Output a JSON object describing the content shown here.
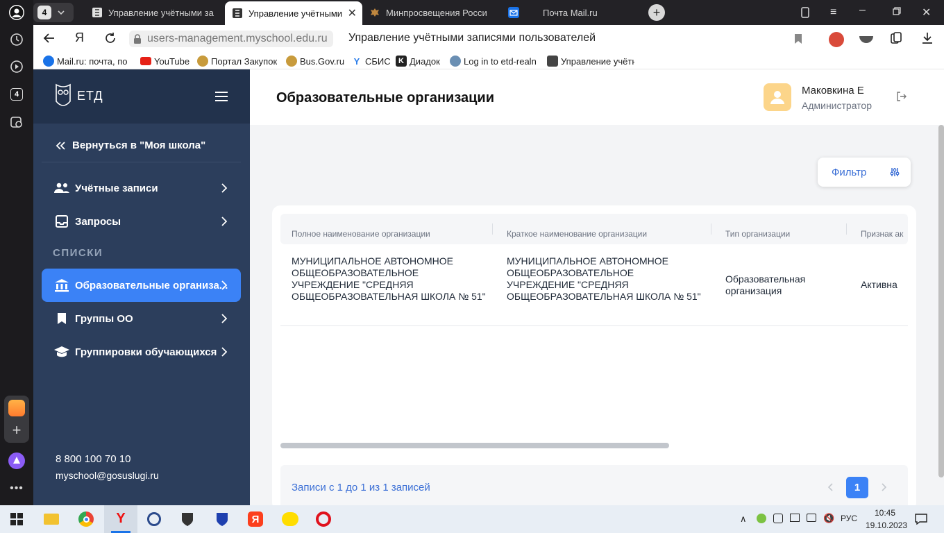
{
  "browser": {
    "tab_count": "4",
    "tabs": [
      {
        "title": "Управление учётными за"
      },
      {
        "title": "Управление учётными"
      },
      {
        "title": "Минпросвещения Росси"
      },
      {
        "title": "Почта Mail.ru"
      }
    ],
    "url": "users-management.myschool.edu.ru",
    "page_title": "Управление учётными записями пользователей",
    "bookmarks": [
      {
        "label": "Mail.ru: почта, по"
      },
      {
        "label": "YouTube"
      },
      {
        "label": "Портал Закупок"
      },
      {
        "label": "Bus.Gov.ru"
      },
      {
        "label": "СБИС"
      },
      {
        "label": "Диадок"
      },
      {
        "label": "Log in to etd-realn"
      },
      {
        "label": "Управление учётн"
      }
    ],
    "rail_badge": "4"
  },
  "sidebar": {
    "logo": "ЕТД",
    "back_label": "Вернуться в \"Моя школа\"",
    "items": [
      {
        "label": "Учётные записи"
      },
      {
        "label": "Запросы"
      }
    ],
    "section_title": "СПИСКИ",
    "list_items": [
      {
        "label": "Образовательные организа..."
      },
      {
        "label": "Группы ОО"
      },
      {
        "label": "Группировки обучающихся"
      }
    ],
    "phone": "8 800 100 70 10",
    "email": "myschool@gosuslugi.ru"
  },
  "header": {
    "title": "Образовательные организации",
    "user_name": "Маковкина Е",
    "user_role": "Администратор"
  },
  "filter_label": "Фильтр",
  "table": {
    "columns": [
      "Полное наименование организации",
      "Краткое наименование организации",
      "Тип организации",
      "Признак ак"
    ],
    "rows": [
      {
        "full_name": "МУНИЦИПАЛЬНОЕ АВТОНОМНОЕ ОБЩЕОБРАЗОВАТЕЛЬНОЕ УЧРЕЖДЕНИЕ \"СРЕДНЯЯ ОБЩЕОБРАЗОВАТЕЛЬНАЯ ШКОЛА № 51\"",
        "short_name": "МУНИЦИПАЛЬНОЕ АВТОНОМНОЕ ОБЩЕОБРАЗОВАТЕЛЬНОЕ УЧРЕЖДЕНИЕ \"СРЕДНЯЯ ОБЩЕОБРАЗОВАТЕЛЬНАЯ ШКОЛА № 51\"",
        "type": "Образовательная организация",
        "status": "Активна"
      }
    ]
  },
  "pagination": {
    "summary": "Записи с 1 до 1 из 1 записей",
    "current_page": "1"
  },
  "taskbar": {
    "lang": "РУС",
    "time": "10:45",
    "date": "19.10.2023"
  },
  "colors": {
    "sidebar": "#2c3e5c",
    "sidebar_top": "#22324c",
    "accent": "#3b82f6",
    "avatar": "#fcd58a"
  }
}
